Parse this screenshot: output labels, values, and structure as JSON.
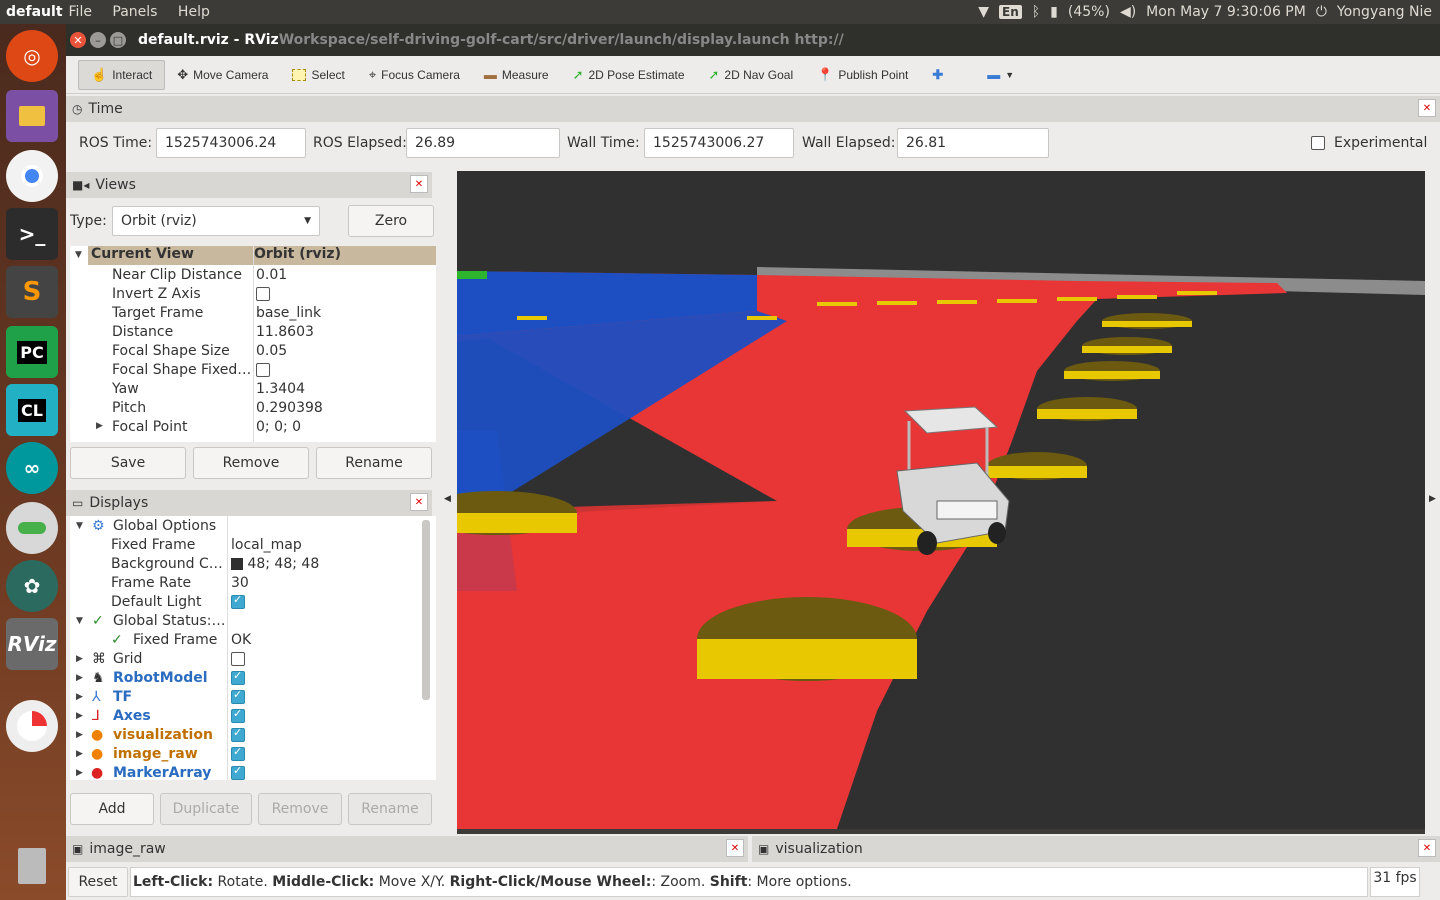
{
  "topbar": {
    "app_name": "default",
    "menus": [
      "File",
      "Panels",
      "Help"
    ],
    "keyboard": "En",
    "battery": "(45%)",
    "datetime": "Mon May 7  9:30:06 PM",
    "user": "Yongyang Nie"
  },
  "window": {
    "title": "default.rviz - RViz",
    "path": "Workspace/self-driving-golf-cart/src/driver/launch/display.launch http://"
  },
  "toolbar": {
    "interact": "Interact",
    "move_camera": "Move Camera",
    "select": "Select",
    "focus_camera": "Focus Camera",
    "measure": "Measure",
    "pose_estimate": "2D Pose Estimate",
    "nav_goal": "2D Nav Goal",
    "publish_point": "Publish Point"
  },
  "time_panel": {
    "title": "Time",
    "ros_time_label": "ROS Time:",
    "ros_time": "1525743006.24",
    "ros_elapsed_label": "ROS Elapsed:",
    "ros_elapsed": "26.89",
    "wall_time_label": "Wall Time:",
    "wall_time": "1525743006.27",
    "wall_elapsed_label": "Wall Elapsed:",
    "wall_elapsed": "26.81",
    "experimental": "Experimental"
  },
  "views_panel": {
    "title": "Views",
    "type_label": "Type:",
    "type_value": "Orbit (rviz)",
    "zero": "Zero",
    "header_key": "Current View",
    "header_value": "Orbit (rviz)",
    "props": [
      {
        "k": "Near Clip Distance",
        "v": "0.01"
      },
      {
        "k": "Invert Z Axis",
        "v": ""
      },
      {
        "k": "Target Frame",
        "v": "base_link"
      },
      {
        "k": "Distance",
        "v": "11.8603"
      },
      {
        "k": "Focal Shape Size",
        "v": "0.05"
      },
      {
        "k": "Focal Shape Fixed…",
        "v": ""
      },
      {
        "k": "Yaw",
        "v": "1.3404"
      },
      {
        "k": "Pitch",
        "v": "0.290398"
      },
      {
        "k": "Focal Point",
        "v": "0; 0; 0"
      }
    ],
    "save": "Save",
    "remove": "Remove",
    "rename": "Rename"
  },
  "displays_panel": {
    "title": "Displays",
    "rows": [
      {
        "k": "Global Options",
        "v": ""
      },
      {
        "k": "Fixed Frame",
        "v": "local_map"
      },
      {
        "k": "Background C…",
        "v": "48; 48; 48"
      },
      {
        "k": "Frame Rate",
        "v": "30"
      },
      {
        "k": "Default Light",
        "v": ""
      },
      {
        "k": "Global Status:…",
        "v": ""
      },
      {
        "k": "Fixed Frame",
        "v": "OK"
      },
      {
        "k": "Grid",
        "v": ""
      },
      {
        "k": "RobotModel",
        "v": ""
      },
      {
        "k": "TF",
        "v": ""
      },
      {
        "k": "Axes",
        "v": ""
      },
      {
        "k": "visualization",
        "v": ""
      },
      {
        "k": "image_raw",
        "v": ""
      },
      {
        "k": "MarkerArray",
        "v": ""
      }
    ],
    "add": "Add",
    "duplicate": "Duplicate",
    "remove": "Remove",
    "rename": "Rename"
  },
  "bottom_panels": {
    "image_raw": "image_raw",
    "visualization": "visualization"
  },
  "status": {
    "reset": "Reset",
    "left_click": "Left-Click:",
    "left_click_desc": " Rotate. ",
    "middle_click": "Middle-Click:",
    "middle_click_desc": " Move X/Y. ",
    "right_click": "Right-Click/Mouse Wheel:",
    "right_click_desc": ": Zoom. ",
    "shift": "Shift",
    "shift_desc": ": More options.",
    "fps": "31 fps"
  },
  "colors": {
    "accent": "#3fa9d2",
    "road": "#e83535",
    "lane": "#1d4fc2",
    "marker": "#e8c800",
    "background": "#303030"
  }
}
